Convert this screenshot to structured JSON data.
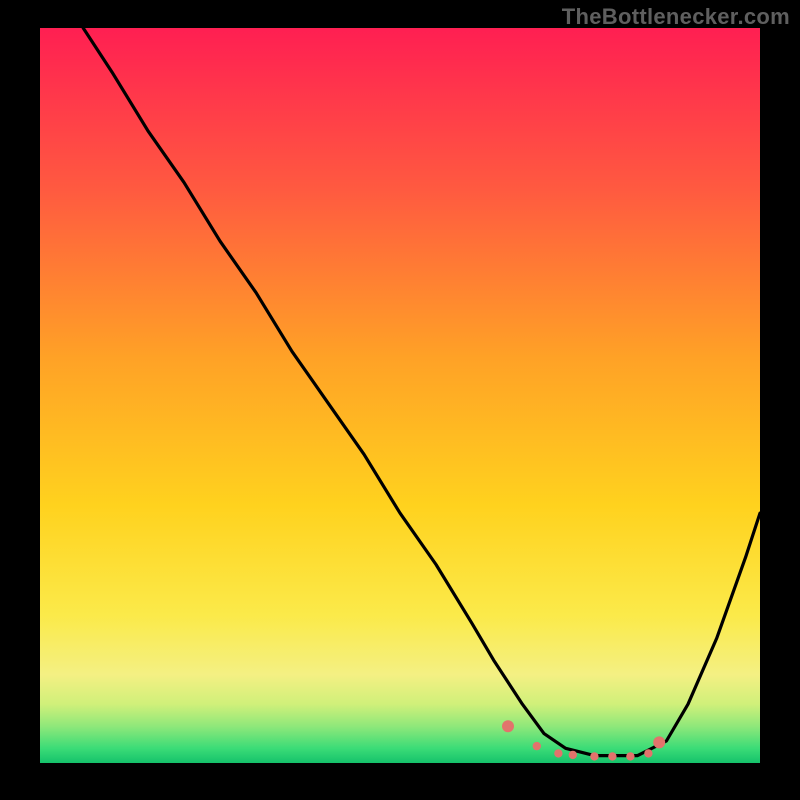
{
  "watermark": "TheBottlenecker.com",
  "colors": {
    "top": "#ff1f52",
    "mid_top": "#ff6a3a",
    "mid": "#ffd21e",
    "mid_low": "#f8ef6f",
    "low1": "#d8f57c",
    "low2": "#7ae97a",
    "low3": "#1fd873",
    "bg": "#000000",
    "line": "#000000",
    "dots": "#e2736c"
  },
  "chart_data": {
    "type": "line",
    "title": "",
    "xlabel": "",
    "ylabel": "",
    "xlim": [
      0,
      100
    ],
    "ylim": [
      0,
      100
    ],
    "series": [
      {
        "name": "bottleneck-curve",
        "x": [
          6,
          10,
          15,
          20,
          25,
          30,
          35,
          40,
          45,
          50,
          55,
          60,
          63,
          67,
          70,
          73,
          77,
          80,
          83,
          87,
          90,
          94,
          98,
          100
        ],
        "values": [
          100,
          94,
          86,
          79,
          71,
          64,
          56,
          49,
          42,
          34,
          27,
          19,
          14,
          8,
          4,
          2,
          1,
          1,
          1,
          3,
          8,
          17,
          28,
          34
        ]
      }
    ],
    "annotations": {
      "optimal_band": {
        "x_start": 65,
        "x_end": 86,
        "color": "#e2736c"
      }
    },
    "dots": {
      "x": [
        65,
        69,
        72,
        74,
        77,
        79.5,
        82,
        84.5,
        86
      ],
      "y": [
        5,
        2.3,
        1.3,
        1.1,
        0.9,
        0.9,
        0.9,
        1.3,
        2.8
      ]
    }
  }
}
